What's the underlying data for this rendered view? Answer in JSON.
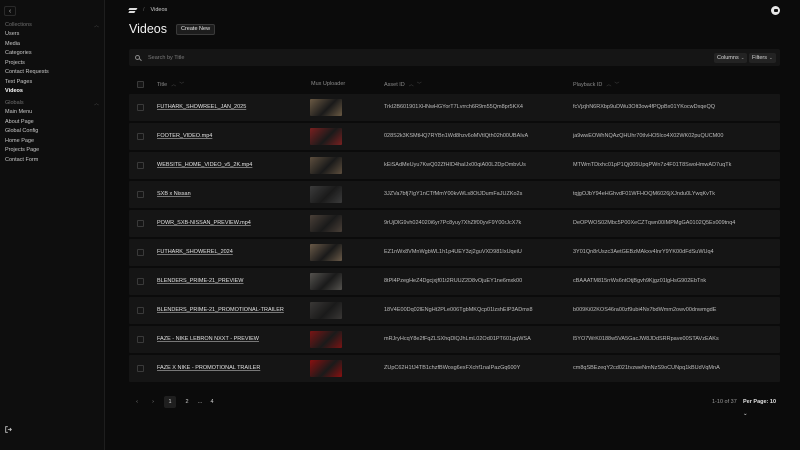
{
  "sidebar": {
    "back_icon": "chevron-left-icon",
    "collections_label": "Collections",
    "collections": [
      "Users",
      "Media",
      "Categories",
      "Projects",
      "Contact Requests",
      "Text Pages",
      "Videos"
    ],
    "active": "Videos",
    "globals_label": "Globals",
    "globals": [
      "Main Menu",
      "About Page",
      "Global Config",
      "Home Page",
      "Projects Page",
      "Contact Form"
    ],
    "logout_icon": "logout-icon"
  },
  "header": {
    "breadcrumb_current": "Videos",
    "title": "Videos",
    "create_label": "Create New"
  },
  "search": {
    "placeholder": "Search by Title",
    "columns_label": "Columns",
    "filters_label": "Filters"
  },
  "table": {
    "columns": [
      "Title",
      "Mux Uploader",
      "Asset ID",
      "Playback ID"
    ],
    "rows": [
      {
        "title": "FUTHARK_SHOWREEL_JAN_2025",
        "asset_id": "TrkI2B601901XHNwHGYorT7Lvrrch6R9m55Qm8pr5KX4",
        "playback_id": "fcVjzjhN6RXbp9uDWu3Olt3ow4fPQpBx01YKocwDxqeQQ",
        "thumb": "#6b5a44"
      },
      {
        "title": "FOOTER_VIDEO.mp4",
        "asset_id": "028S2k3KSMtHQ7RYBn1Wd8hzv6oMVtlQth02h00UBAIvA",
        "playback_id": "ja9wwEOWhNQAzQHUhr70tIvHO5lco4X02WK02puQUCM00",
        "thumb": "#7a2020"
      },
      {
        "title": "WEBSITE_HOME_VIDEO_v5_2K.mp4",
        "asset_id": "kEiSAdMeUyu7KwQ02ZfHID4haIJx00qiA00L2DpOmbvUs",
        "playback_id": "MTWmTDixhc01pP1Qj005UpqPWn7z4F01T8SwoHmwAD7uqTk",
        "thumb": "#5e4f3e"
      },
      {
        "title": "SXB x Nissan",
        "asset_id": "3JZVa7bfj7IgY1nCTfMmY00kvWLs8OtJDumFaJUZKo2s",
        "playback_id": "tqjgOJbY94eHGhvdF01WFHOQM6026jXJndu0LYwqKvTk",
        "thumb": "#3c3c3c"
      },
      {
        "title": "POWR_SXB-NISSAN_PREVIEW.mp4",
        "asset_id": "9rUjDlG9vh024020i6yr7Pc8yuy7XhZlf00yvF9Y00rJcX7k",
        "playback_id": "DeOPWOS02Mbc5P00XeCZTqwn00IMPMgGA0102Q5Ex009tnq4",
        "thumb": "#4a4038"
      },
      {
        "title": "FUTHARK_SHOWEREL_2024",
        "asset_id": "EZ1nWx8VMnWgbWL1h1p4UEY3zj2guVXD981IxUqeiU",
        "playback_id": "3Y01Qn8rUszc3AetGEBzMAkxv4InrY9YK00dFdSuWUq4",
        "thumb": "#6a5a48"
      },
      {
        "title": "BLENDERS_PRIME-21_PREVIEW",
        "asset_id": "8tPl4PzegHeZ4Dgcjxjf01t2RUUZ2D8vOjuEY1ne6mxk00",
        "playback_id": "cBAAATM815rrWs6ntOtjBgvh9Kjgz01lgHsG902EbTnk",
        "thumb": "#55534f"
      },
      {
        "title": "BLENDERS_PRIME-21_PROMOTIONAL-TRAILER",
        "asset_id": "18V4E00Dq02lENgHt2PLe006TgbMKQcp01lzshElP3ADmx8",
        "playback_id": "b009Ki02KOS46ra00zf9ubi4Nx7bdWmm2owv00dnwmgdE",
        "thumb": "#3a3836"
      },
      {
        "title": "FAZE - NIKE LEBRON NXXT - PREVIEW",
        "asset_id": "mRJryHcqY8e2fFqZLSXhqDlQJhLmL02Od01PT601gqWSA",
        "playback_id": "l5YO7WrK0188w5VA5GacJW8JDdSRRpave00STAVzEAKs",
        "thumb": "#7a1414"
      },
      {
        "title": "FAZE X NIKE - PROMOTIONAL TRAILER",
        "asset_id": "ZUpC62H1fJ4TB1chzfBWosg6exFXchf1naIPazGq600Y",
        "playback_id": "cm8qSBEzeqY2cd021tvzweNmNzS9oCUNpq1kBUdVqMnA",
        "thumb": "#8a1010"
      }
    ]
  },
  "pagination": {
    "prev_icon": "chevron-left-icon",
    "next_icon": "chevron-right-icon",
    "pages": [
      "1",
      "2",
      "...",
      "4"
    ],
    "current": "1",
    "range": "1-10 of 37",
    "per_page_label": "Per Page:",
    "per_page_value": "10"
  }
}
